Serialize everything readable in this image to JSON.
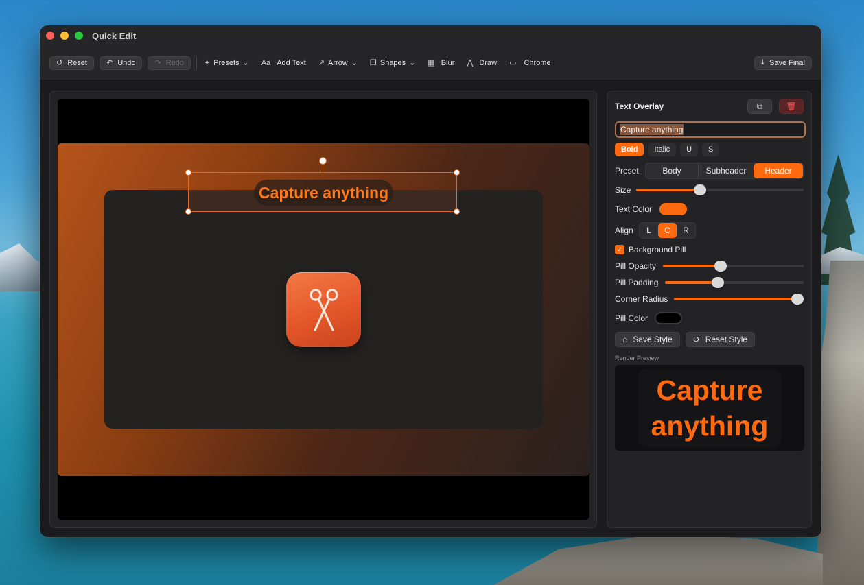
{
  "window": {
    "title": "Quick Edit"
  },
  "toolbar": {
    "reset": "Reset",
    "undo": "Undo",
    "redo": "Redo",
    "presets": "Presets",
    "add_text": "Add Text",
    "add_text_icon_label": "Aa",
    "arrow": "Arrow",
    "shapes": "Shapes",
    "blur": "Blur",
    "draw": "Draw",
    "chrome": "Chrome",
    "save_final": "Save Final"
  },
  "canvas": {
    "overlay_text": "Capture anything"
  },
  "inspector": {
    "title": "Text Overlay",
    "text_value": "Capture anything",
    "styles": [
      "Bold",
      "Italic",
      "U",
      "S"
    ],
    "active_style": "Bold",
    "preset_label": "Preset",
    "presets": [
      "Body",
      "Subheader",
      "Header"
    ],
    "active_preset": "Header",
    "size_label": "Size",
    "size_value": 0.38,
    "text_color_label": "Text Color",
    "text_color": "#ff6a10",
    "align_label": "Align",
    "align_options": [
      "L",
      "C",
      "R"
    ],
    "active_align": "C",
    "background_pill_label": "Background Pill",
    "background_pill_checked": true,
    "pill_opacity_label": "Pill Opacity",
    "pill_opacity_value": 0.41,
    "pill_padding_label": "Pill Padding",
    "pill_padding_value": 0.38,
    "corner_radius_label": "Corner Radius",
    "corner_radius_value": 0.95,
    "pill_color_label": "Pill Color",
    "pill_color": "#000000",
    "save_style": "Save Style",
    "reset_style": "Reset Style",
    "render_preview_label": "Render Preview",
    "preview_text": "Capture anything"
  },
  "colors": {
    "accent": "#ff6a10"
  }
}
